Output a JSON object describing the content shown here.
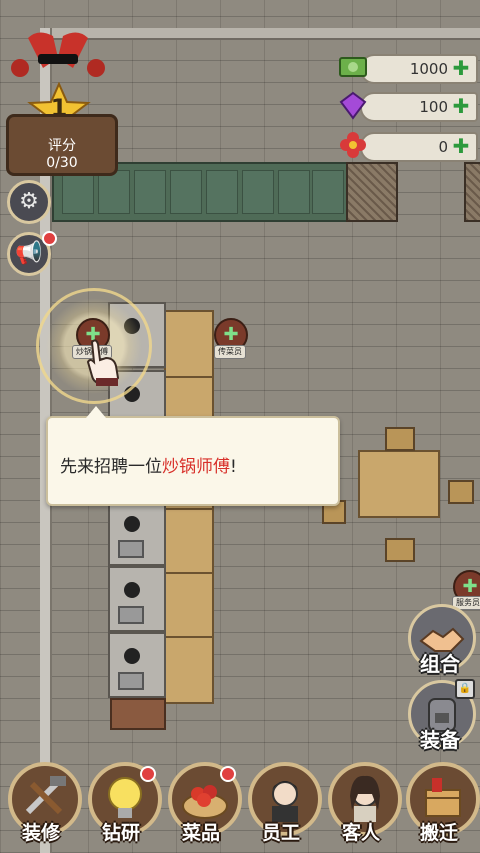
{
  "rating": {
    "label": "评分",
    "progress": "0/30",
    "level": "1"
  },
  "currencies": [
    {
      "name": "cash",
      "value": "1000",
      "icon": "cash-icon"
    },
    {
      "name": "gem",
      "value": "100",
      "icon": "purple-gem-icon"
    },
    {
      "name": "flower",
      "value": "0",
      "icon": "red-flower-icon"
    }
  ],
  "markers": {
    "cook": "炒锅师傅",
    "waiter": "传菜员",
    "server": "服务员"
  },
  "tooltip": {
    "prefix": "先来招聘一位",
    "highlight": "炒锅师傅",
    "suffix": "!"
  },
  "side": {
    "combo": "组合",
    "equip": "装备"
  },
  "nav": [
    {
      "label": "装修",
      "icon": "hammer-wrench-icon"
    },
    {
      "label": "钻研",
      "icon": "lightbulb-icon"
    },
    {
      "label": "菜品",
      "icon": "crayfish-dish-icon"
    },
    {
      "label": "员工",
      "icon": "staff-portrait-icon"
    },
    {
      "label": "客人",
      "icon": "guest-portrait-icon"
    },
    {
      "label": "搬迁",
      "icon": "moving-box-icon"
    }
  ],
  "colors": {
    "highlight": "#d8302a",
    "plus": "#2c9a3c",
    "panel": "#4f6b57"
  }
}
